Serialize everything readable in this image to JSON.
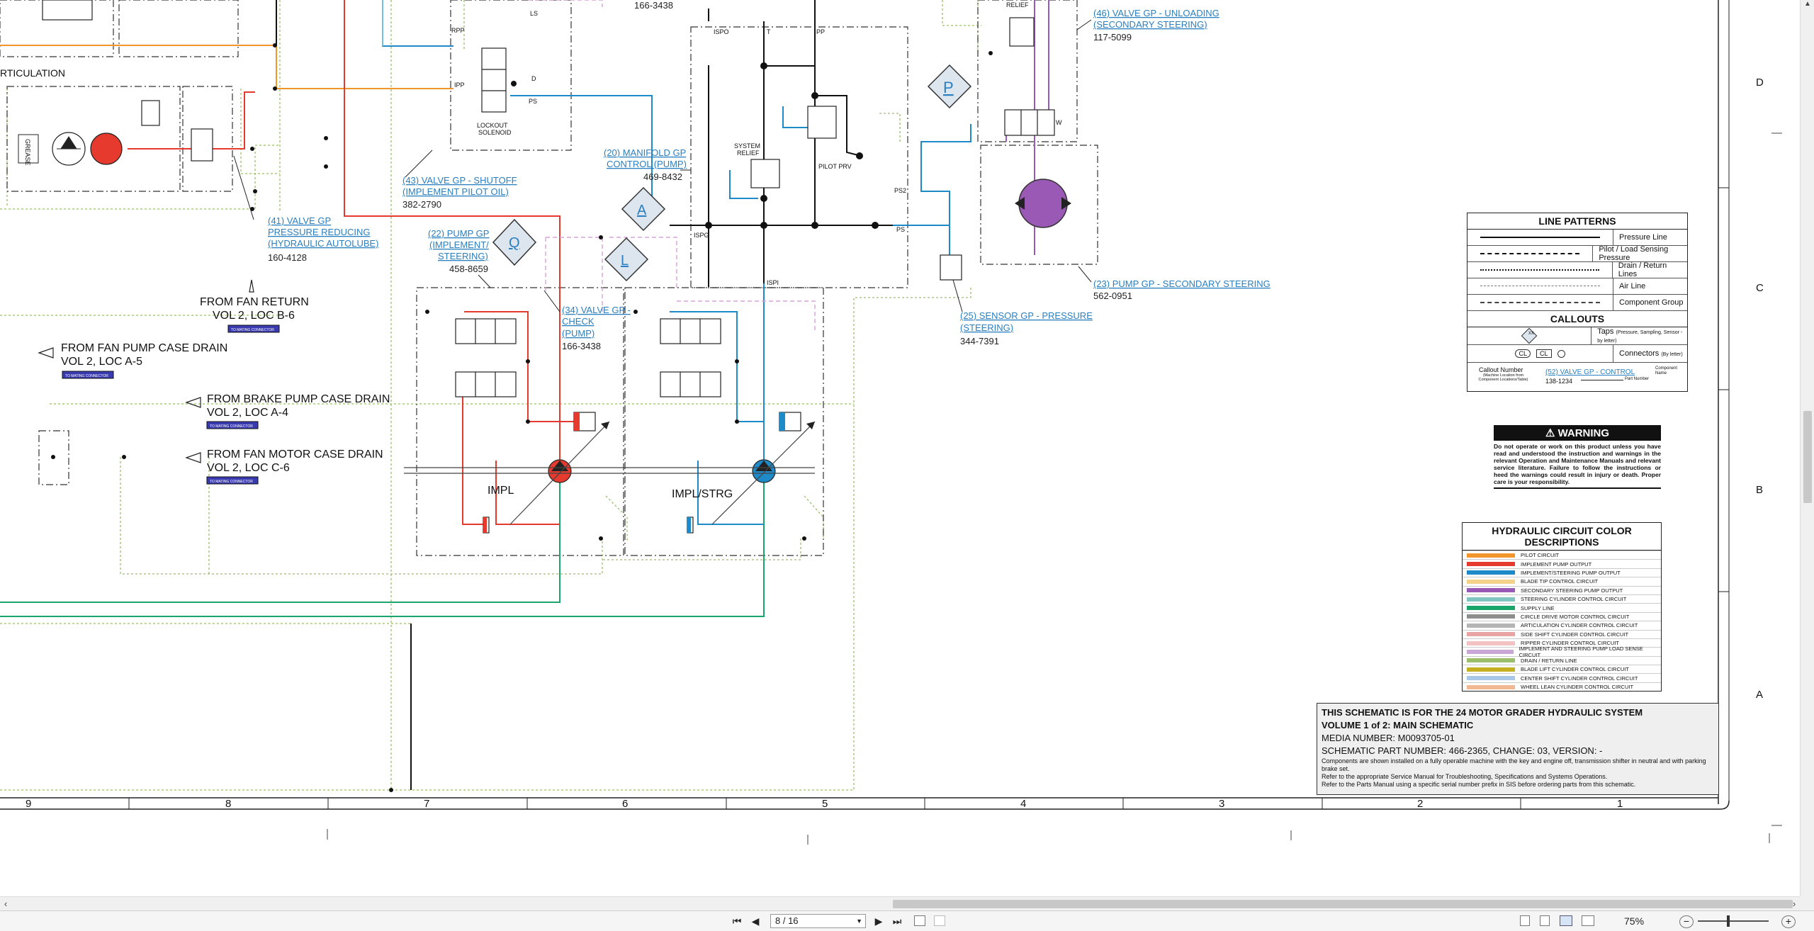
{
  "labels": {
    "articulation": "RTICULATION",
    "grease": "GREASE",
    "rpp": "RPP",
    "ipp": "IPP",
    "ls": "LS",
    "d": "D",
    "ps": "PS",
    "lockout_l1": "LOCKOUT",
    "lockout_l2": "SOLENOID",
    "pn_166_top": "166-3438",
    "ispo": "ISPO",
    "t": "T",
    "pp": "PP",
    "relief": "RELIEF",
    "system_relief_1": "SYSTEM",
    "system_relief_2": "RELIEF",
    "pilot_prv": "PILOT PRV",
    "ps2": "PS2",
    "ps_b": "PS",
    "ispg": "ISPG",
    "ispi": "ISPI",
    "impl": "IMPL",
    "impl_strg": "IMPL/STRG",
    "tap_p": "P",
    "tap_a": "A",
    "tap_q": "Q",
    "tap_l": "L",
    "w": "W",
    "fan_return_1": "FROM FAN RETURN",
    "fan_return_2": "VOL 2, LOC B-6",
    "fan_pump_1": "FROM FAN PUMP CASE DRAIN",
    "fan_pump_2": "VOL 2, LOC A-5",
    "brake_pump_1": "FROM BRAKE PUMP CASE DRAIN",
    "brake_pump_2": "VOL 2, LOC A-4",
    "fan_motor_1": "FROM FAN MOTOR CASE DRAIN",
    "fan_motor_2": "VOL 2, LOC C-6",
    "mating": "TO MATING CONNECTOR"
  },
  "callouts": {
    "c46_1": "(46) VALVE GP - UNLOADING",
    "c46_2": "(SECONDARY STEERING)",
    "c46_pn": "117-5099",
    "c43_1": "(43) VALVE GP - SHUTOFF",
    "c43_2": "(IMPLEMENT PILOT OIL)",
    "c43_pn": "382-2790",
    "c20_1": "(20) MANIFOLD GP",
    "c20_2": "CONTROL (PUMP)",
    "c20_pn": "469-8432",
    "c41_1": "(41) VALVE GP",
    "c41_2": "PRESSURE REDUCING",
    "c41_3": "(HYDRAULIC AUTOLUBE)",
    "c41_pn": "160-4128",
    "c22_1": "(22) PUMP GP",
    "c22_2": "(IMPLEMENT/",
    "c22_3": "STEERING)",
    "c22_pn": "458-8659",
    "c34_1": "(34) VALVE GP -",
    "c34_2": "CHECK",
    "c34_3": "(PUMP)",
    "c34_pn": "166-3438",
    "c25_1": "(25) SENSOR GP - PRESSURE",
    "c25_2": "(STEERING)",
    "c25_pn": "344-7391",
    "c23_1": "(23) PUMP GP - SECONDARY STEERING",
    "c23_pn": "562-0951"
  },
  "grid": {
    "rows": [
      "D",
      "C",
      "B",
      "A"
    ],
    "cols": [
      "9",
      "8",
      "7",
      "6",
      "5",
      "4",
      "3",
      "2",
      "1"
    ]
  },
  "line_patterns": {
    "title": "LINE PATTERNS",
    "items": [
      "Pressure Line",
      "Pilot / Load Sensing Pressure",
      "Drain / Return Lines",
      "Air Line",
      "Component Group"
    ],
    "callouts_title": "CALLOUTS",
    "taps": "Taps",
    "taps_note": "(Pressure, Sampling, Sensor - by letter)",
    "connectors": "Connectors",
    "connectors_note": "(By letter)",
    "tap_glyph": "XX",
    "conn_glyph_1": "CL",
    "conn_glyph_2": "CL",
    "callout_number": "Callout Number",
    "callout_note": "(Machine Location from Component Locations/Table)",
    "example_link": "(52) VALVE GP - CONTROL",
    "example_pn": "138-1234",
    "component_name": "Component Name",
    "part_number": "Part Number"
  },
  "warning": {
    "title": "WARNING",
    "body": "Do not operate or work on this product unless you have read and understood the instruction and warnings in the relevant Operation and Maintenance Manuals and relevant service literature. Failure to follow the instructions or heed the warnings could result in injury or death. Proper care is your responsibility."
  },
  "color_desc": {
    "title": "HYDRAULIC CIRCUIT COLOR DESCRIPTIONS",
    "items": [
      {
        "label": "PILOT CIRCUIT",
        "color": "#f0962a"
      },
      {
        "label": "IMPLEMENT PUMP OUTPUT",
        "color": "#e63a2e"
      },
      {
        "label": "IMPLEMENT/STEERING PUMP OUTPUT",
        "color": "#1f8ac8"
      },
      {
        "label": "BLADE TIP CONTROL CIRCUIT",
        "color": "#f4d28a"
      },
      {
        "label": "SECONDARY STEERING PUMP OUTPUT",
        "color": "#9b59b6"
      },
      {
        "label": "STEERING CYLINDER CONTROL CIRCUIT",
        "color": "#7fc6c2"
      },
      {
        "label": "SUPPLY LINE",
        "color": "#1aa56b"
      },
      {
        "label": "CIRCLE DRIVE MOTOR CONTROL CIRCUIT",
        "color": "#8e8e8e"
      },
      {
        "label": "ARTICULATION CYLINDER CONTROL CIRCUIT",
        "color": "#b5b5b5"
      },
      {
        "label": "SIDE SHIFT CYLINDER CONTROL CIRCUIT",
        "color": "#e8a3a3"
      },
      {
        "label": "RIPPER CYLINDER CONTROL CIRCUIT",
        "color": "#f3c3c3"
      },
      {
        "label": "IMPLEMENT AND STEERING PUMP LOAD SENSE CIRCUIT",
        "color": "#c9a6d6"
      },
      {
        "label": "DRAIN / RETURN LINE",
        "color": "#9bbf6a"
      },
      {
        "label": "BLADE LIFT CYLINDER CONTROL CIRCUIT",
        "color": "#c7b020"
      },
      {
        "label": "CENTER SHIFT CYLINDER CONTROL CIRCUIT",
        "color": "#a9c7e6"
      },
      {
        "label": "WHEEL LEAN CYLINDER CONTROL CIRCUIT",
        "color": "#f2b892"
      }
    ]
  },
  "title_block": {
    "l1": "THIS SCHEMATIC IS FOR THE 24 MOTOR GRADER HYDRAULIC SYSTEM",
    "l2": "VOLUME 1 of 2: MAIN SCHEMATIC",
    "l3": "MEDIA NUMBER: M0093705-01",
    "l4": "SCHEMATIC PART NUMBER: 466-2365, CHANGE: 03, VERSION: -",
    "l5": "Components are shown installed on a fully operable machine with the key and engine off, transmission shifter in neutral and with parking brake set.",
    "l6": "Refer to the appropriate Service Manual for Troubleshooting, Specifications and Systems Operations.",
    "l7": "Refer to the Parts Manual using a specific serial number prefix in SIS before ordering parts from this schematic."
  },
  "toolbar": {
    "first": "⏮",
    "prev": "◀",
    "page": "8 / 16",
    "next": "▶",
    "last": "⏭",
    "zoom": "75%",
    "zoom_out": "−",
    "zoom_in": "+"
  }
}
